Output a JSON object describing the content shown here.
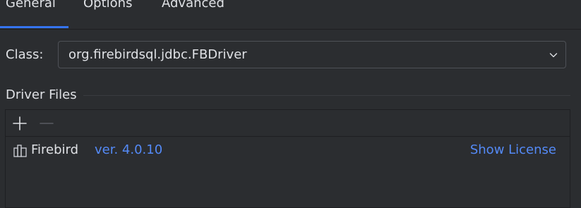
{
  "tabs": [
    {
      "label": "General",
      "selected": true
    },
    {
      "label": "Options",
      "selected": false
    },
    {
      "label": "Advanced",
      "selected": false
    }
  ],
  "class_field": {
    "label": "Class:",
    "value": "org.firebirdsql.jdbc.FBDriver"
  },
  "driver_files": {
    "title": "Driver Files",
    "toolbar": {
      "add_icon": "plus-icon",
      "remove_icon": "minus-icon",
      "remove_enabled": false
    },
    "items": [
      {
        "icon": "library-icon",
        "name": "Firebird",
        "version": "ver. 4.0.10",
        "link": "Show License"
      }
    ]
  },
  "colors": {
    "background": "#2b2d30",
    "accent": "#3574f0",
    "link": "#548af7",
    "text": "#dfe1e5",
    "border": "#1e1f22",
    "disabled": "#5a5d63"
  }
}
